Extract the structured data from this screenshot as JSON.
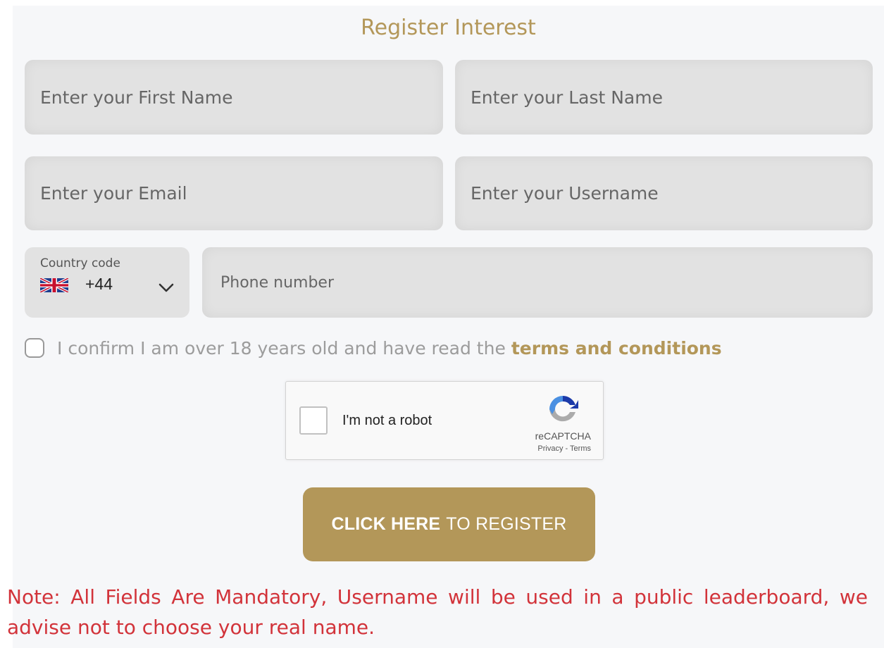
{
  "form": {
    "title": "Register Interest",
    "first_name": {
      "placeholder": "Enter your First Name",
      "value": ""
    },
    "last_name": {
      "placeholder": "Enter your Last Name",
      "value": ""
    },
    "email": {
      "placeholder": "Enter your Email",
      "value": ""
    },
    "username": {
      "placeholder": "Enter your Username",
      "value": ""
    },
    "country_code": {
      "label": "Country code",
      "value": "+44",
      "flag_icon": "uk-flag-icon"
    },
    "phone": {
      "placeholder": "Phone number",
      "value": ""
    },
    "terms": {
      "text": "I confirm I am over 18 years old and have read the",
      "link": "terms and conditions"
    },
    "recaptcha": {
      "label": "I'm not a robot",
      "brand": "reCAPTCHA",
      "links": "Privacy - Terms"
    },
    "register_button": {
      "strong": "CLICK HERE",
      "rest": "TO REGISTER"
    },
    "note": "Note: All Fields Are Mandatory, Username will be used in a public leaderboard, we advise not to choose your real name."
  },
  "colors": {
    "accent": "#b39759",
    "field_bg": "#e2e2e2",
    "note": "#d2333a",
    "panel_bg": "#f6f7f9"
  }
}
